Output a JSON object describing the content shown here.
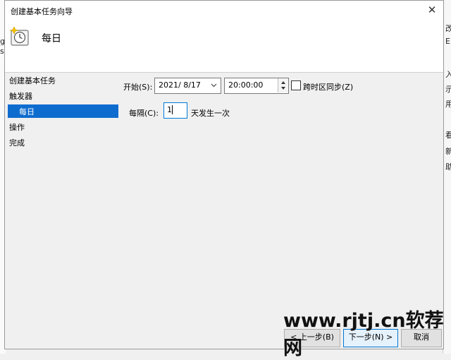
{
  "background_window": {
    "right_chars": [
      "改",
      "E",
      "入",
      "示",
      "用",
      "看",
      "新",
      "助"
    ],
    "left_chars": [
      "g",
      "s"
    ]
  },
  "dialog": {
    "title": "创建基本任务向导",
    "close_glyph": "✕",
    "header_title": "每日"
  },
  "nav": {
    "items": [
      "创建基本任务",
      "触发器",
      "每日",
      "操作",
      "完成"
    ]
  },
  "form": {
    "start_label": "开始(S):",
    "start_date": "2021/  8/17",
    "start_time": "20:00:00",
    "sync_label": "跨时区同步(Z)",
    "sync_checked": false,
    "every_label": "每隔(C):",
    "every_value": "1",
    "every_suffix": "天发生一次"
  },
  "buttons": {
    "back": "< 上一步(B)",
    "next": "下一步(N) >",
    "cancel": "取消"
  },
  "watermark": "www.rjtj.cn软荐网",
  "icons": [
    "clock-icon",
    "close-icon",
    "chevron-down-icon",
    "spinner-up-icon",
    "spinner-down-icon"
  ]
}
